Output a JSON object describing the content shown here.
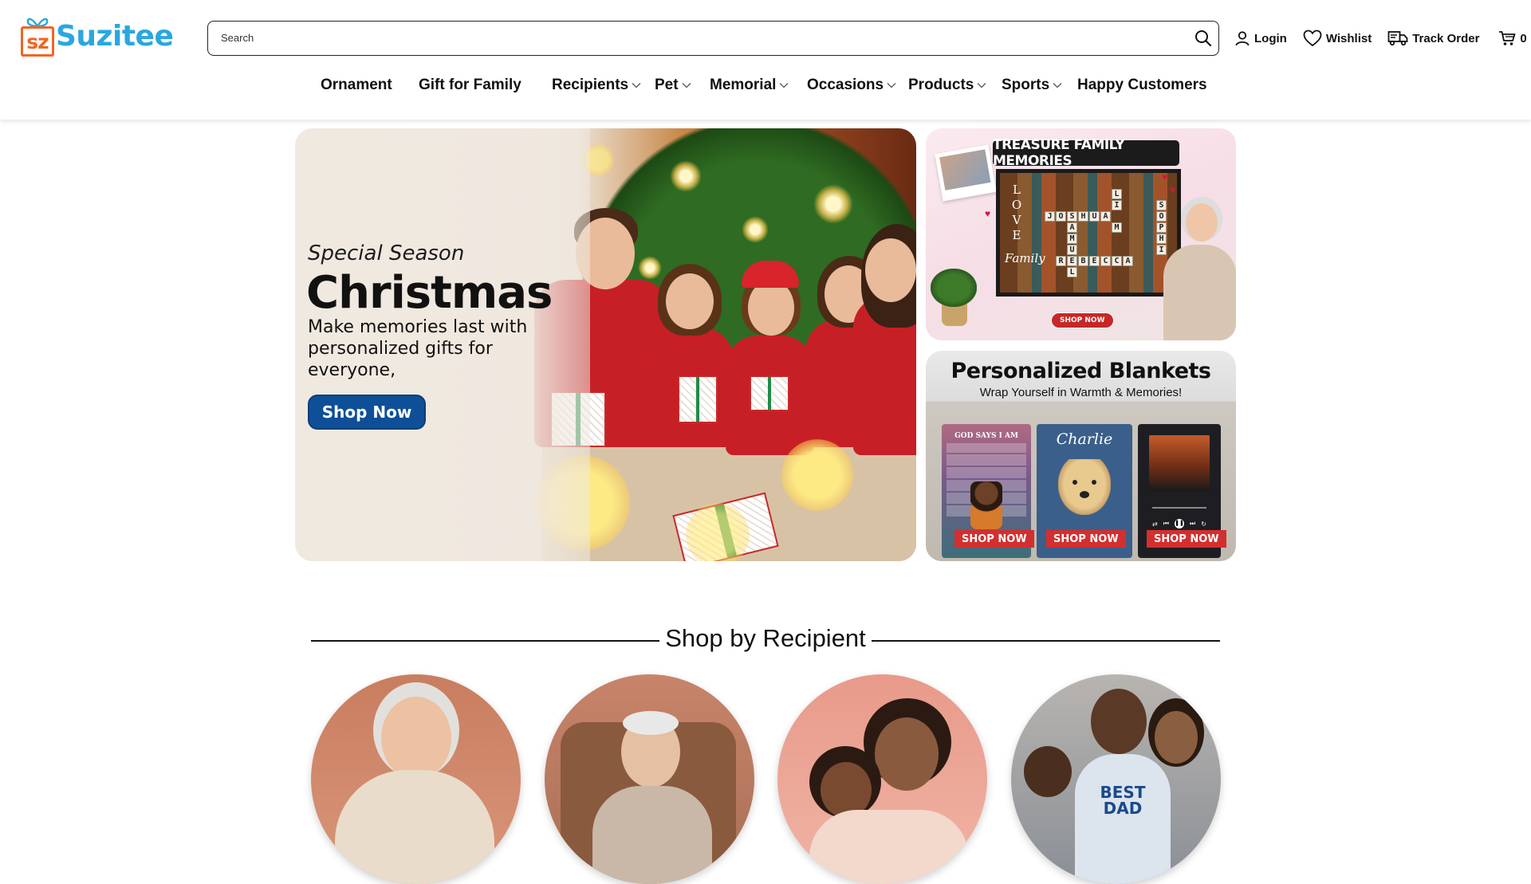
{
  "brand": {
    "logo_mark": "sz",
    "name": "Suzitee"
  },
  "search": {
    "placeholder": "Search"
  },
  "header_actions": {
    "login": "Login",
    "wishlist": "Wishlist",
    "track_order": "Track Order",
    "cart_count": "0"
  },
  "nav": [
    {
      "label": "Ornament",
      "has_dropdown": false
    },
    {
      "label": "Gift for Family",
      "has_dropdown": false
    },
    {
      "label": "Recipients",
      "has_dropdown": true
    },
    {
      "label": "Pet",
      "has_dropdown": true
    },
    {
      "label": "Memorial",
      "has_dropdown": true
    },
    {
      "label": "Occasions",
      "has_dropdown": true
    },
    {
      "label": "Products",
      "has_dropdown": true
    },
    {
      "label": "Sports",
      "has_dropdown": true
    },
    {
      "label": "Happy Customers",
      "has_dropdown": false
    }
  ],
  "hero": {
    "kicker": "Special Season",
    "title": "Christmas",
    "subtitle": "Make memories last with personalized gifts for everyone,",
    "cta": "Shop Now"
  },
  "banner_family": {
    "title": "TREASURE FAMILY MEMORIES",
    "love": "LOVE",
    "family": "Family",
    "names": [
      "JOSHUA",
      "SAMUEL",
      "REBECCA",
      "LIAM",
      "SOPHIE"
    ],
    "cta": "SHOP NOW"
  },
  "banner_blankets": {
    "title": "Personalized Blankets",
    "subtitle": "Wrap Yourself in Warmth & Memories!",
    "blanket_1_text": "GOD SAYS I AM",
    "blanket_2_text": "Charlie",
    "cta_1": "SHOP NOW",
    "cta_2": "SHOP NOW",
    "cta_3": "SHOP NOW"
  },
  "shop_by_recipient": {
    "title": "Shop by Recipient"
  },
  "colors": {
    "brand_blue": "#2aa7df",
    "brand_orange": "#f26522",
    "hero_button": "#0e4f97",
    "shop_now_red": "#d32f2f"
  }
}
